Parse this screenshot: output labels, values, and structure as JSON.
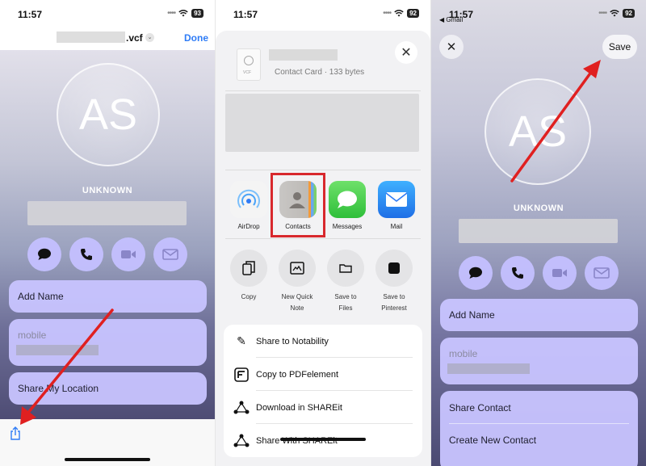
{
  "status": {
    "p1_time": "11:57",
    "p1_battery": "93",
    "p2_time": "11:57",
    "p2_battery": "92",
    "p3_time": "11:57",
    "p3_battery": "92",
    "p3_back": "◀ Gmail"
  },
  "panel1": {
    "filename_suffix": ".vcf",
    "done": "Done",
    "initials": "AS",
    "unknown": "UNKNOWN",
    "add_name": "Add Name",
    "mobile": "mobile",
    "share_location": "Share My Location"
  },
  "panel2": {
    "file_meta": "Contact Card · 133 bytes",
    "apps": [
      {
        "label": "AirDrop"
      },
      {
        "label": "Contacts"
      },
      {
        "label": "Messages"
      },
      {
        "label": "Mail"
      }
    ],
    "actions": [
      {
        "label": "Copy"
      },
      {
        "label": "New Quick\nNote"
      },
      {
        "label": "Save to Files"
      },
      {
        "label": "Save to\nPinterest"
      }
    ],
    "menu": [
      {
        "label": "Share to Notability"
      },
      {
        "label": "Copy to PDFelement"
      },
      {
        "label": "Download in SHAREit"
      },
      {
        "label": "Share With SHAREit"
      }
    ]
  },
  "panel3": {
    "save": "Save",
    "initials": "AS",
    "unknown": "UNKNOWN",
    "add_name": "Add Name",
    "mobile": "mobile",
    "share_contact": "Share Contact",
    "create_new_contact": "Create New Contact"
  },
  "colors": {
    "card": "#c8c4ff",
    "accent": "#2f7cf6",
    "arrow": "#e02020"
  }
}
